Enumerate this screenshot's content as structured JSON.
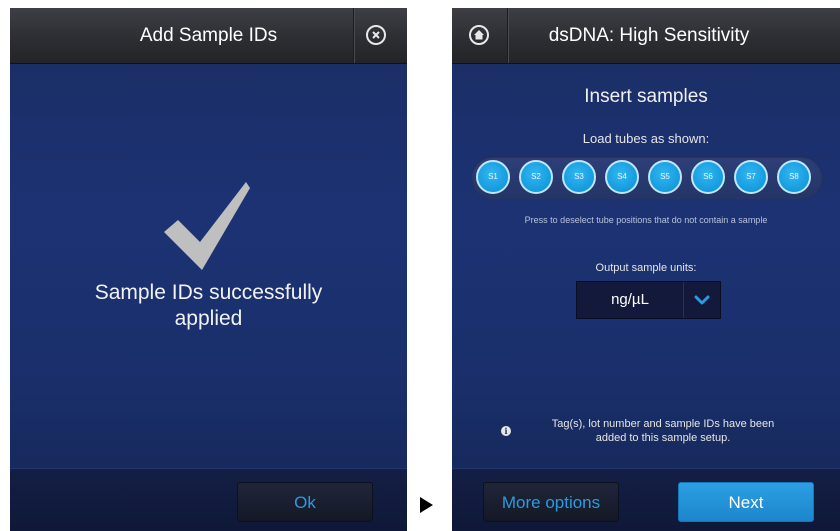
{
  "left_screen": {
    "title": "Add Sample IDs",
    "close_icon": "close-circle-icon",
    "check_icon": "checkmark-icon",
    "message_line1": "Sample IDs successfully",
    "message_line2": "applied",
    "ok_label": "Ok"
  },
  "right_screen": {
    "home_icon": "home-icon",
    "title": "dsDNA: High Sensitivity",
    "heading": "Insert samples",
    "load_label": "Load tubes as shown:",
    "tubes": [
      "S1",
      "S2",
      "S3",
      "S4",
      "S5",
      "S6",
      "S7",
      "S8"
    ],
    "deselect_hint": "Press to deselect tube positions that do not contain a sample",
    "units_label": "Output sample units:",
    "units_value": "ng/µL",
    "dropdown_icon": "chevron-down-icon",
    "info_icon": "info-icon",
    "info_line1": "Tag(s), lot number and sample IDs have been",
    "info_line2": "added to this sample setup.",
    "more_options_label": "More options",
    "next_label": "Next"
  },
  "transition_icon": "arrow-right-icon",
  "colors": {
    "accent_blue": "#2a9be0",
    "tube_blue": "#139bde",
    "background_navy": "#1c3273"
  }
}
